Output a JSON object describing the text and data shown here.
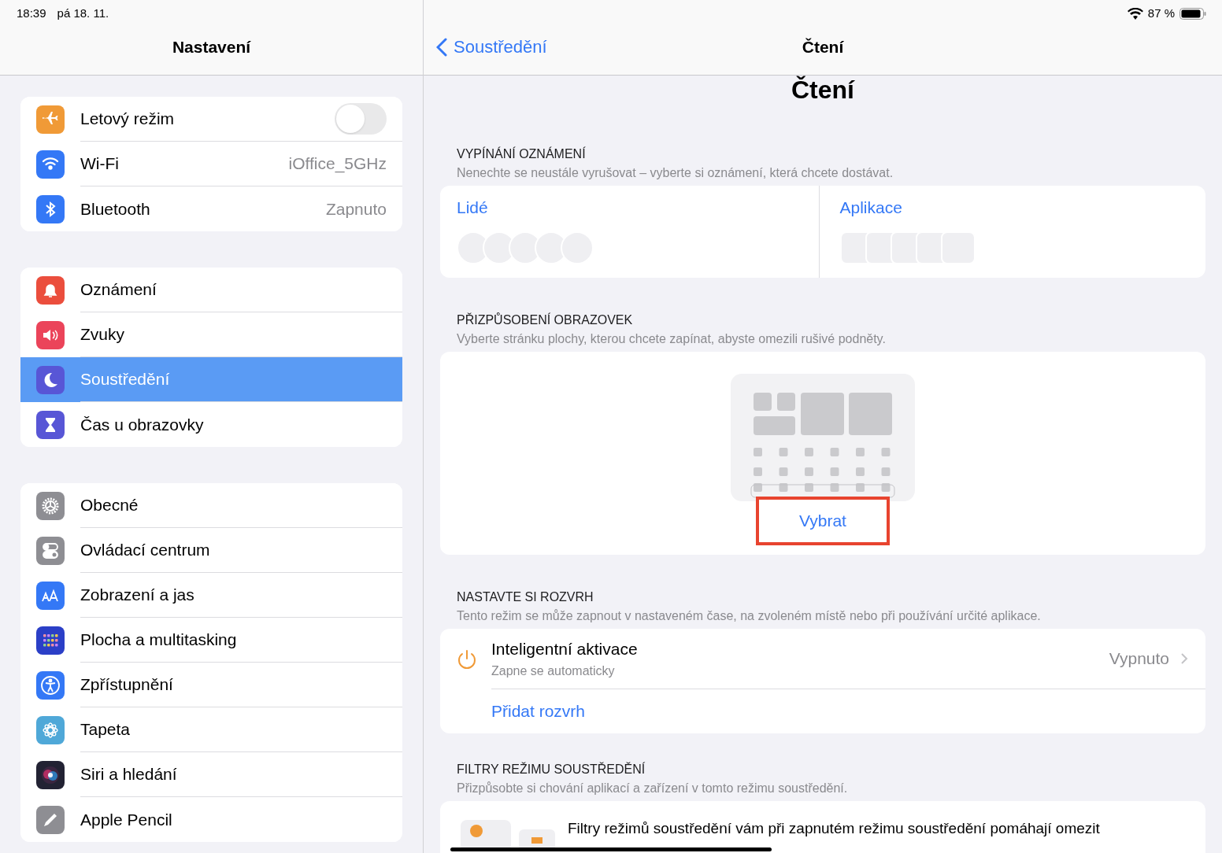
{
  "status_bar": {
    "time": "18:39",
    "date": "pá 18. 11.",
    "battery": "87 %"
  },
  "sidebar": {
    "title": "Nastavení",
    "groups": [
      [
        {
          "label": "Letový režim",
          "color": "#f09a37",
          "kind": "toggle",
          "on": false,
          "selected": false
        },
        {
          "label": "Wi-Fi",
          "color": "#3478f6",
          "kind": "value",
          "value": "iOffice_5GHz",
          "selected": false
        },
        {
          "label": "Bluetooth",
          "color": "#3478f6",
          "kind": "value",
          "value": "Zapnuto",
          "selected": false
        }
      ],
      [
        {
          "label": "Oznámení",
          "color": "#eb4e3d",
          "kind": "plain",
          "selected": false
        },
        {
          "label": "Zvuky",
          "color": "#eb445a",
          "kind": "plain",
          "selected": false
        },
        {
          "label": "Soustředění",
          "color": "#5856d6",
          "kind": "plain",
          "selected": true
        },
        {
          "label": "Čas u obrazovky",
          "color": "#5856d6",
          "kind": "plain",
          "selected": false
        }
      ],
      [
        {
          "label": "Obecné",
          "color": "#8e8e93",
          "kind": "plain",
          "selected": false
        },
        {
          "label": "Ovládací centrum",
          "color": "#8e8e93",
          "kind": "plain",
          "selected": false
        },
        {
          "label": "Zobrazení a jas",
          "color": "#3478f6",
          "kind": "plain",
          "selected": false
        },
        {
          "label": "Plocha a multitasking",
          "color": "#2b3fc7",
          "kind": "plain",
          "selected": false
        },
        {
          "label": "Zpřístupnění",
          "color": "#3478f6",
          "kind": "plain",
          "selected": false
        },
        {
          "label": "Tapeta",
          "color": "#4fa8d8",
          "kind": "plain",
          "selected": false
        },
        {
          "label": "Siri a hledání",
          "color": "#222233",
          "kind": "plain",
          "selected": false
        },
        {
          "label": "Apple Pencil",
          "color": "#8e8e93",
          "kind": "plain",
          "selected": false
        }
      ]
    ]
  },
  "detail": {
    "back": "Soustředění",
    "title": "Čtení",
    "large_title": "Čtení",
    "notifications": {
      "header": "VYPÍNÁNÍ OZNÁMENÍ",
      "description": "Nenechte se neustále vyrušovat – vyberte si oznámení, která chcete dostávat.",
      "people": "Lidé",
      "apps": "Aplikace"
    },
    "screens": {
      "header": "PŘIZPŮSOBENÍ OBRAZOVEK",
      "description": "Vyberte stránku plochy, kterou chcete zapínat, abyste omezili rušivé podněty.",
      "button": "Vybrat"
    },
    "schedule": {
      "header": "NASTAVTE SI ROZVRH",
      "description": "Tento režim se může zapnout v nastaveném čase, na zvoleném místě nebo při používání určité aplikace.",
      "smart_title": "Inteligentní aktivace",
      "smart_subtitle": "Zapne se automaticky",
      "smart_value": "Vypnuto",
      "add": "Přidat rozvrh"
    },
    "filters": {
      "header": "FILTRY REŽIMU SOUSTŘEDĚNÍ",
      "description": "Přizpůsobte si chování aplikací a zařízení v tomto režimu soustředění.",
      "text": "Filtry režimů soustředění vám při zapnutém režimu soustředění pomáhají omezit"
    }
  }
}
